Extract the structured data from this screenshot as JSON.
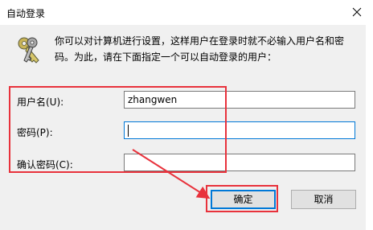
{
  "window": {
    "title": "自动登录",
    "close_icon": "close-icon"
  },
  "description": {
    "icon": "keys-icon",
    "text_line1": "你可以对计算机进行设置，这样用户在登录时就不必输入用户名和密",
    "text_line2": "码。为此，请在下面指定一个可以自动登录的用户："
  },
  "form": {
    "username_label": "用户名(U):",
    "username_value": "zhangwen",
    "password_label": "密码(P):",
    "password_value": "",
    "confirm_label": "确认密码(C):",
    "confirm_value": ""
  },
  "buttons": {
    "ok_label": "确定",
    "cancel_label": "取消"
  },
  "annotation": {
    "color": "#e8323c"
  }
}
